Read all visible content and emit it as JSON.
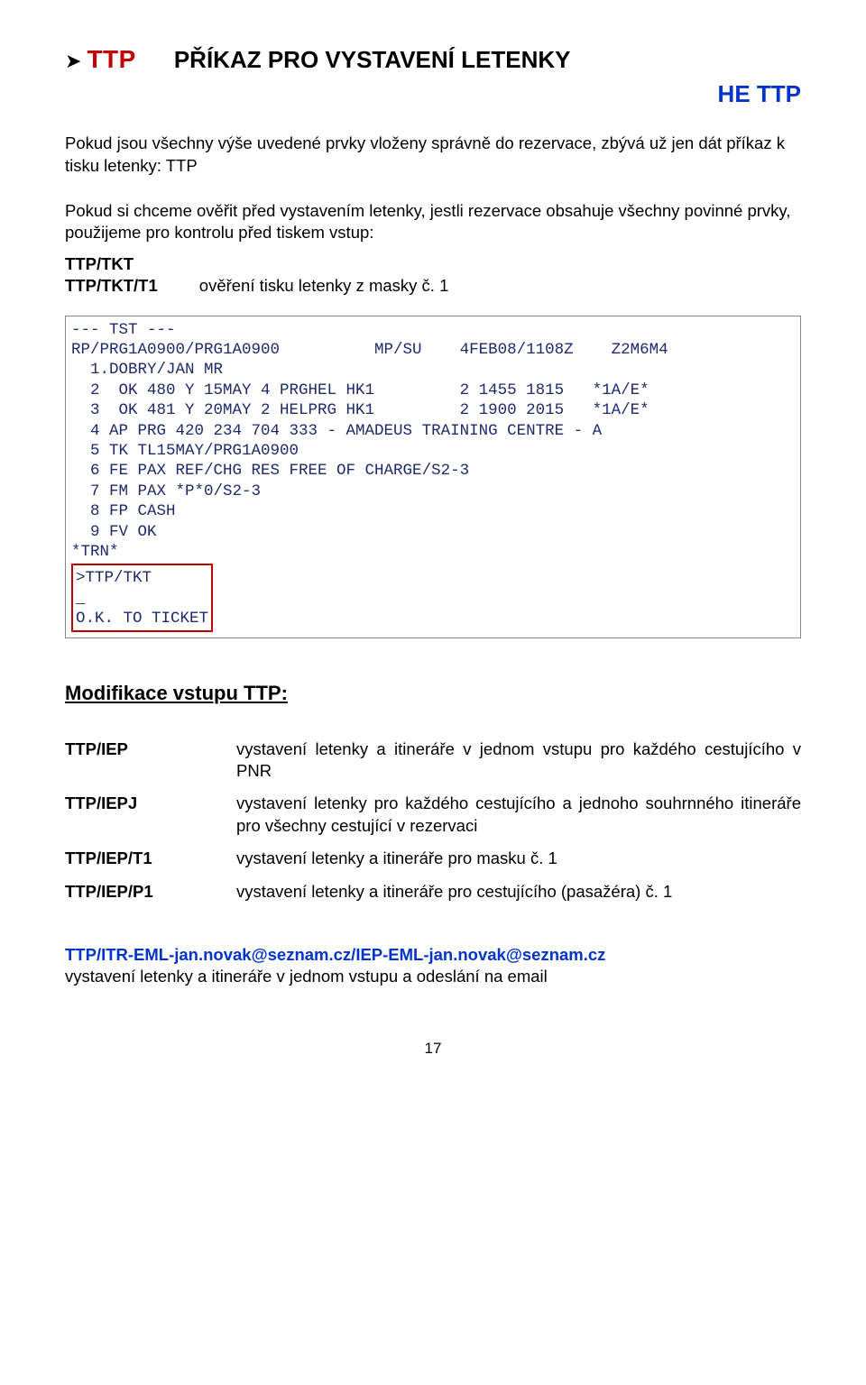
{
  "header": {
    "ttp_red": "TTP",
    "title": "PŘÍKAZ PRO VYSTAVENÍ LETENKY",
    "he_ttp": "HE TTP"
  },
  "p1": "Pokud jsou všechny výše uvedené prvky vloženy správně do rezervace, zbývá už jen dát příkaz k tisku letenky: TTP",
  "p2": "Pokud si chceme ověřit před vystavením letenky, jestli rezervace obsahuje všechny povinné prvky, použijeme pro kontrolu před tiskem vstup:",
  "cmds": {
    "r1": {
      "left": "TTP/TKT",
      "right": ""
    },
    "r2": {
      "left": "TTP/TKT/T1",
      "right": "ověření tisku letenky z masky č. 1"
    }
  },
  "tst": {
    "l0": "--- TST ---",
    "l1": "RP/PRG1A0900/PRG1A0900          MP/SU    4FEB08/1108Z    Z2M6M4",
    "l2": "  1.DOBRY/JAN MR",
    "l3": "  2  OK 480 Y 15MAY 4 PRGHEL HK1         2 1455 1815   *1A/E*",
    "l4": "  3  OK 481 Y 20MAY 2 HELPRG HK1         2 1900 2015   *1A/E*",
    "l5": "  4 AP PRG 420 234 704 333 - AMADEUS TRAINING CENTRE - A",
    "l6": "  5 TK TL15MAY/PRG1A0900",
    "l7": "  6 FE PAX REF/CHG RES FREE OF CHARGE/S2-3",
    "l8": "  7 FM PAX *P*0/S2-3",
    "l9": "  8 FP CASH",
    "l10": "  9 FV OK",
    "l11": "*TRN*",
    "l12": ">TTP/TKT",
    "caret": "_",
    "ok": "O.K. TO TICKET"
  },
  "mod_h": "Modifikace vstupu TTP:",
  "mod": [
    {
      "left": "TTP/IEP",
      "right": "vystavení letenky a itineráře v jednom vstupu pro každého cestujícího v PNR"
    },
    {
      "left": "TTP/IEPJ",
      "right": "vystavení letenky pro každého cestujícího a jednoho souhrnného itineráře pro všechny cestující v rezervaci"
    },
    {
      "left": "TTP/IEP/T1",
      "right": "vystavení letenky a itineráře pro masku č. 1"
    },
    {
      "left": "TTP/IEP/P1",
      "right": "vystavení letenky a itineráře pro cestujícího (pasažéra) č. 1"
    }
  ],
  "email_cmd": "TTP/ITR-EML-jan.novak@seznam.cz/IEP-EML-jan.novak@seznam.cz",
  "email_desc": "vystavení letenky a itineráře v jednom vstupu a odeslání na email",
  "page_num": "17"
}
